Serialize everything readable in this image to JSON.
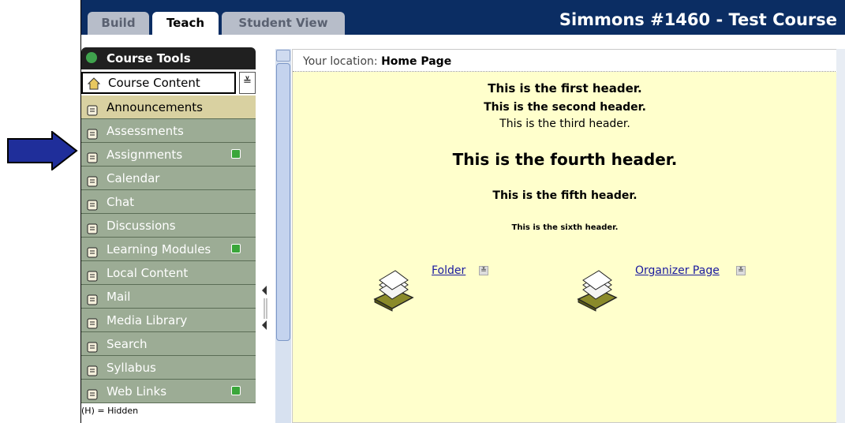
{
  "tabs": [
    {
      "label": "Build"
    },
    {
      "label": "Teach"
    },
    {
      "label": "Student View"
    }
  ],
  "course_title": "Simmons #1460 - Test Course",
  "tools": {
    "header": "Course Tools",
    "course_content": "Course Content",
    "items": [
      {
        "label": "Announcements",
        "icon": "megaphone-icon",
        "selected": true,
        "new": false
      },
      {
        "label": "Assessments",
        "icon": "assessment-icon",
        "selected": false,
        "new": false
      },
      {
        "label": "Assignments",
        "icon": "pencil-icon",
        "selected": false,
        "new": true
      },
      {
        "label": "Calendar",
        "icon": "calendar-icon",
        "selected": false,
        "new": false
      },
      {
        "label": "Chat",
        "icon": "chat-bubble-icon",
        "selected": false,
        "new": false
      },
      {
        "label": "Discussions",
        "icon": "pushpin-icon",
        "selected": false,
        "new": false
      },
      {
        "label": "Learning Modules",
        "icon": "modules-icon",
        "selected": false,
        "new": true
      },
      {
        "label": "Local Content",
        "icon": "disc-icon",
        "selected": false,
        "new": false
      },
      {
        "label": "Mail",
        "icon": "envelope-icon",
        "selected": false,
        "new": false
      },
      {
        "label": "Media Library",
        "icon": "media-icon",
        "selected": false,
        "new": false
      },
      {
        "label": "Search",
        "icon": "magnifier-icon",
        "selected": false,
        "new": false
      },
      {
        "label": "Syllabus",
        "icon": "syllabus-icon",
        "selected": false,
        "new": false
      },
      {
        "label": "Web Links",
        "icon": "globe-icon",
        "selected": false,
        "new": true
      }
    ],
    "hidden_note": "(H) = Hidden"
  },
  "content": {
    "location_label": "Your location:",
    "location_value": "Home Page",
    "headers": [
      "This is the first header.",
      "This is the second header.",
      "This is the third header.",
      "This is the fourth header.",
      "This is the fifth header.",
      "This is the sixth header."
    ],
    "items": [
      {
        "label": "Folder",
        "icon": "folder-stack-icon"
      },
      {
        "label": "Organizer Page",
        "icon": "folder-stack-icon"
      }
    ]
  },
  "colors": {
    "top_bar": "#0b2d63",
    "tool_bg": "#9cac95",
    "tool_selected": "#d9d1a1",
    "content_bg": "#ffffcc",
    "new_badge": "#3aa63a",
    "arrow": "#1f2e9a"
  }
}
